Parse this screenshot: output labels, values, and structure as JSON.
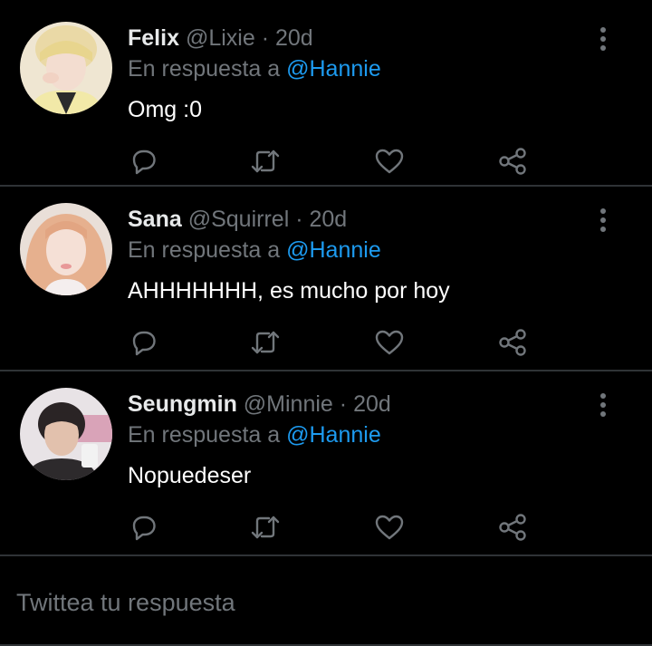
{
  "colors": {
    "background": "#000000",
    "muted": "#71767b",
    "accent": "#1d9bf0",
    "divider": "#2f3336",
    "text": "#ffffff"
  },
  "tweets": [
    {
      "name": "Felix",
      "handle": "@Lixie",
      "separator": "·",
      "time": "20d",
      "reply_prefix": "En respuesta a",
      "reply_to": "@Hannie",
      "text": "Omg :0",
      "avatar": "avatar-felix"
    },
    {
      "name": "Sana",
      "handle": "@Squirrel",
      "separator": "·",
      "time": "20d",
      "reply_prefix": "En respuesta a",
      "reply_to": "@Hannie",
      "text": "AHHHHHHH, es mucho por hoy",
      "avatar": "avatar-sana"
    },
    {
      "name": "Seungmin",
      "handle": "@Minnie",
      "separator": "·",
      "time": "20d",
      "reply_prefix": "En respuesta a",
      "reply_to": "@Hannie",
      "text": "Nopuedeser",
      "avatar": "avatar-seungmin"
    }
  ],
  "icons": {
    "reply": "reply-icon",
    "retweet": "retweet-icon",
    "like": "heart-icon",
    "share": "share-icon",
    "more": "more-vertical-icon"
  },
  "composer": {
    "placeholder": "Twittea tu respuesta"
  }
}
